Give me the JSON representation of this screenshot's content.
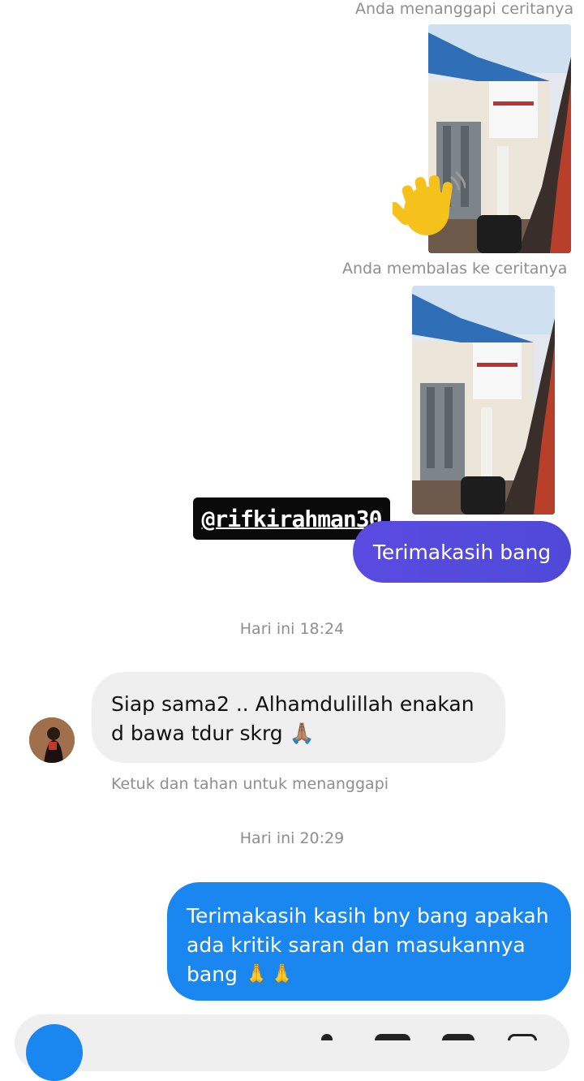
{
  "thread": {
    "reacted_label": "Anda menanggapi ceritanya",
    "replied_label": "Anda membalas ke ceritanya",
    "mention_tag": "@rifkirahman30",
    "reply_bubble": "Terimakasih bang",
    "time_1": "Hari ini 18:24",
    "incoming_message": "Siap sama2 .. Alhamdulillah enakan d bawa tdur skrg 🙏🏽",
    "tap_hint": "Ketuk dan tahan untuk menanggapi",
    "time_2": "Hari ini 20:29",
    "outgoing_message": "Terimakasih kasih bny bang apakah ada kritik saran dan masukannya bang 🙏🙏"
  },
  "icons": {
    "reaction": "waving-hand-icon",
    "avatar": "user-avatar"
  },
  "colors": {
    "purple_bubble": "#5a4be0",
    "blue_bubble": "#1a86f0",
    "gray_bubble": "#efefef",
    "meta_text": "#8e8e8e"
  }
}
